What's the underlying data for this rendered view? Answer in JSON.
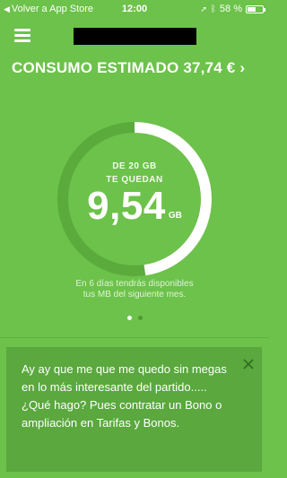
{
  "status_bar": {
    "back_label": "Volver a App Store",
    "time": "12:00",
    "battery_text": "58 %",
    "battery_level": 0.58
  },
  "header": {
    "consumo_label": "CONSUMO ESTIMADO 37,74 €",
    "arrow": "›"
  },
  "gauge": {
    "de_text": "DE 20 GB",
    "te_text": "TE QUEDAN",
    "value": "9,54",
    "unit": "GB",
    "remaining_fraction": 0.477
  },
  "note": {
    "line1": "En 6 días tendrás disponibles",
    "line2": "tus MB del siguiente mes."
  },
  "pager": {
    "count": 2,
    "active": 0
  },
  "card": {
    "message": "Ay ay que me que me quedo sin megas en lo más interesante del partido..... ¿Qué hago? Pues contratar un Bono o ampliación en Tarifas y Bonos."
  },
  "colors": {
    "background": "#6cc24a",
    "card": "#5aa83e",
    "ring_track": "#5aaa3c",
    "ring_fill": "#ffffff"
  }
}
